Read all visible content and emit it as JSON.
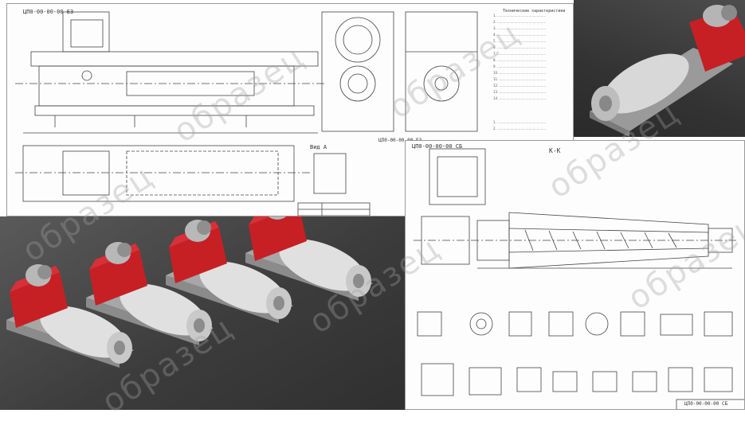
{
  "sheet1": {
    "code_top": "ЦП0-00-00-00 ЕЗ",
    "code_rot": "ЦП0-00-00-00 ЕЗ",
    "view_label": "Вид А",
    "notes_heading": "Технические характеристики"
  },
  "sheet2": {
    "code_top": "ЦП0-00-00-00 СБ",
    "section_label": "К-К",
    "bottom_code": "ЦП0-00-00-00 СБ"
  },
  "watermark": {
    "text": "образец"
  },
  "colors": {
    "housing_red": "#c62025",
    "body_grey": "#cfcfcf",
    "background_dark": "#3a3a3a"
  }
}
